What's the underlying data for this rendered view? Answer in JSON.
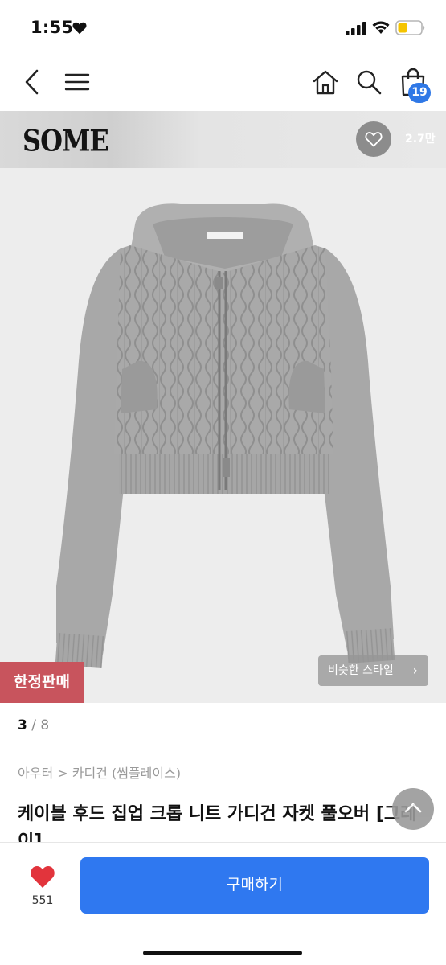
{
  "status_bar": {
    "time": "1:55",
    "icons": [
      "heart-icon",
      "signal-icon",
      "wifi-icon",
      "battery-icon"
    ]
  },
  "nav": {
    "icons": [
      "back-icon",
      "menu-icon",
      "home-icon",
      "search-icon",
      "shopping-bag-icon"
    ],
    "cart_count": "19"
  },
  "brand": {
    "logo_text": "SOME",
    "like_count": "2.7만"
  },
  "product_image": {
    "limited_badge": "한정판매",
    "similar_style": "비슷한 스타일",
    "similar_chevron": "›"
  },
  "pager": {
    "current": "3",
    "separator": " / ",
    "total": "8"
  },
  "breadcrumb": "아우터 > 카디건 (썸플레이스)",
  "title": "케이블 후드 집업 크롭 니트 가디건 자켓 풀오버 [그레이]",
  "bottom_bar": {
    "wish_count": "551",
    "buy_label": "구매하기"
  },
  "colors": {
    "accent": "#2f78f0",
    "limited_badge": "#c8545d",
    "heart": "#e2343c",
    "garment": "#a8a8a8"
  }
}
